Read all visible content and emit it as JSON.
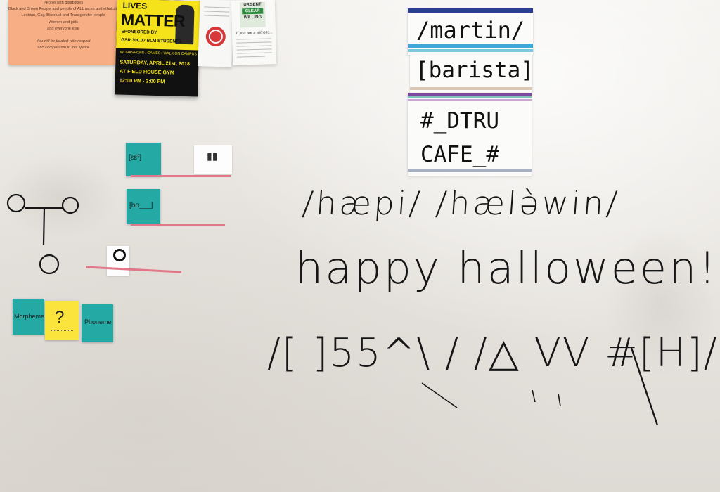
{
  "orange_flyer": {
    "lines": [
      "People with disabilities",
      "Black and Brown People and people of ALL races and ethnicities",
      "Lesbian, Gay, Bisexual and Transgender people",
      "Women and girls",
      "and everyone else",
      "",
      "You will be treated with respect",
      "and compassion in this space"
    ]
  },
  "poster": {
    "line1": "LIVES",
    "line2": "MATTER",
    "line3": "SPONSORED BY",
    "line4": "GSR 300.07 BLM STUDENTS",
    "line5": "WORKSHOPS / GAMES / WALK ON CAMPUS",
    "line6": "SATURDAY, APRIL 21st, 2018",
    "line7": "AT FIELD HOUSE GYM",
    "line8": "12:00 PM - 2:00 PM"
  },
  "flyer_right": {
    "logo_top": "URGENT",
    "logo_mid": "CLEAR",
    "logo_bottom": "WILLING",
    "heading": "If you are a witness..."
  },
  "name_cards": {
    "card1": "/martin/",
    "card2": "[barista]",
    "card3_line1": "#_DTRU",
    "card3_line2": "CAFE_#"
  },
  "stickies": {
    "phonetic1": "[ɛɛ̃²]",
    "phonetic2": "[bo___]",
    "morpheme": "Morpheme",
    "question": "?",
    "phoneme": "Phoneme"
  },
  "board": {
    "ipa_line": "/hæpi/ /hælə̀win/",
    "word_line": "happy halloween!",
    "tone_line": "/[ ]55^\\ / /△ VV #[H]/",
    "tree_node": "O"
  }
}
